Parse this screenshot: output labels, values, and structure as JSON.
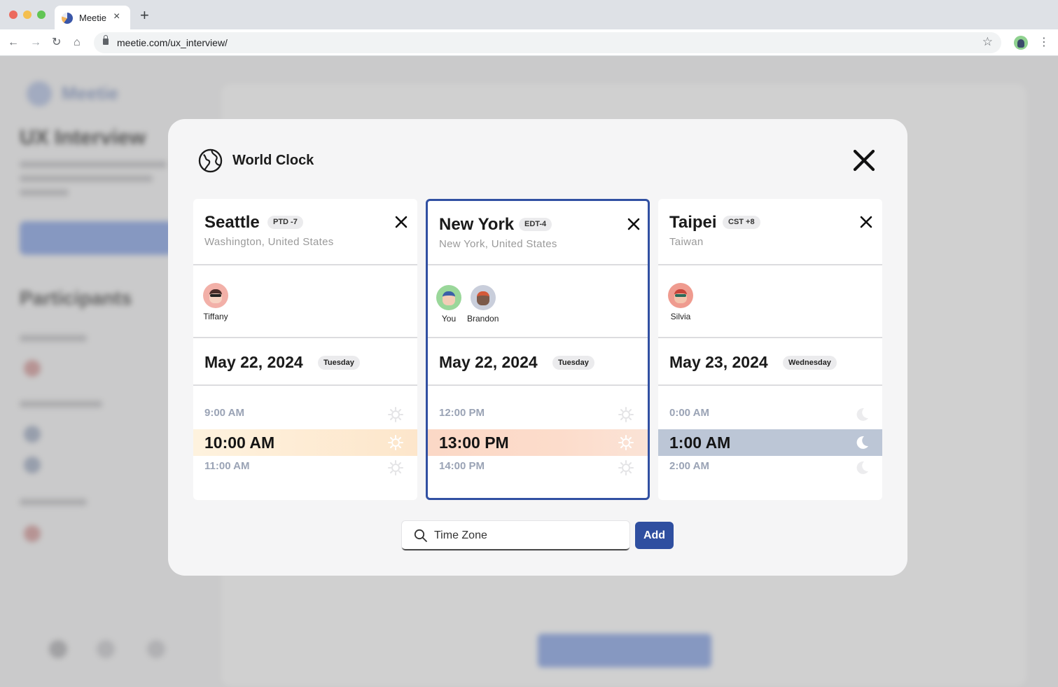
{
  "browser": {
    "tab_title": "Meetie",
    "url": "meetie.com/ux_interview/"
  },
  "background": {
    "brand": "Meetie",
    "title": "UX Interview",
    "participants_heading": "Participants"
  },
  "modal": {
    "title": "World Clock",
    "icon": "globe-icon"
  },
  "cards": [
    {
      "city": "Seattle",
      "tz_badge": "PTD -7",
      "region": "Washington, United States",
      "participants": [
        {
          "name": "Tiffany"
        }
      ],
      "date": "May 22, 2024",
      "day": "Tuesday",
      "times": [
        {
          "label": "9:00 AM",
          "icon": "sun-icon"
        },
        {
          "label": "10:00 AM",
          "icon": "sun-icon"
        },
        {
          "label": "11:00 AM",
          "icon": "sun-icon"
        }
      ],
      "selected": false
    },
    {
      "city": "New York",
      "tz_badge": "EDT-4",
      "region": "New York, United States",
      "participants": [
        {
          "name": "You"
        },
        {
          "name": "Brandon"
        }
      ],
      "date": "May 22, 2024",
      "day": "Tuesday",
      "times": [
        {
          "label": "12:00 PM",
          "icon": "sun-icon"
        },
        {
          "label": "13:00 PM",
          "icon": "sun-icon"
        },
        {
          "label": "14:00 PM",
          "icon": "sun-icon"
        }
      ],
      "selected": true
    },
    {
      "city": "Taipei",
      "tz_badge": "CST +8",
      "region": "Taiwan",
      "participants": [
        {
          "name": "Silvia"
        }
      ],
      "date": "May 23, 2024",
      "day": "Wednesday",
      "times": [
        {
          "label": "0:00 AM",
          "icon": "moon-icon"
        },
        {
          "label": "1:00 AM",
          "icon": "moon-icon"
        },
        {
          "label": "2:00 AM",
          "icon": "moon-icon"
        }
      ],
      "selected": false
    }
  ],
  "search": {
    "placeholder": "Time Zone",
    "add_label": "Add"
  },
  "colors": {
    "accent": "#2f4fa0",
    "seattle_highlight": "#fde9d0",
    "newyork_highlight": "#fbd9c8",
    "taipei_highlight": "#bcc6d6"
  }
}
